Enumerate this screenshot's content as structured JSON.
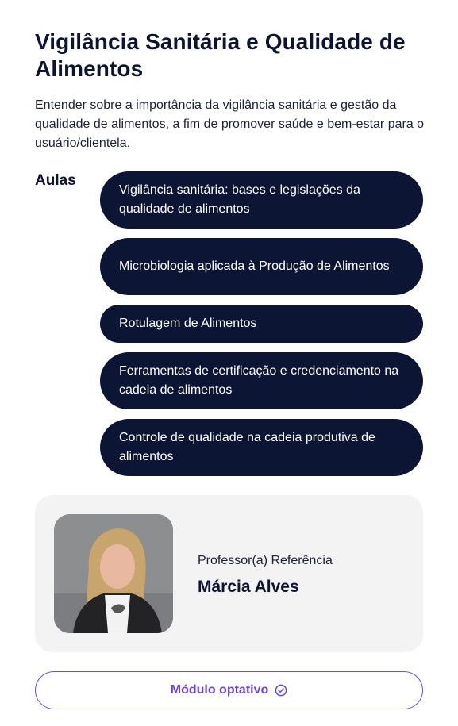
{
  "module": {
    "title": "Vigilância Sanitária e Qualidade de Alimentos",
    "description": "Entender sobre a importância da vigilância sanitária e gestão da qualidade de alimentos, a fim de promover saúde e bem-estar para o usuário/clientela."
  },
  "lessons": {
    "label": "Aulas",
    "items": [
      "Vigilância sanitária: bases e legislações da qualidade de alimentos",
      "Microbiologia aplicada à Produção de Alimentos",
      "Rotulagem de Alimentos",
      "Ferramentas de certificação e credenciamento na cadeia de alimentos",
      "Controle de qualidade na cadeia produtiva de alimentos"
    ]
  },
  "teacher": {
    "role": "Professor(a) Referência",
    "name": "Márcia Alves"
  },
  "footer": {
    "button_label": "Módulo optativo",
    "button_icon": "check-circle-icon"
  },
  "colors": {
    "primary_dark": "#0c1533",
    "accent_purple": "#6a47d3",
    "card_background": "#f3f3f3"
  }
}
